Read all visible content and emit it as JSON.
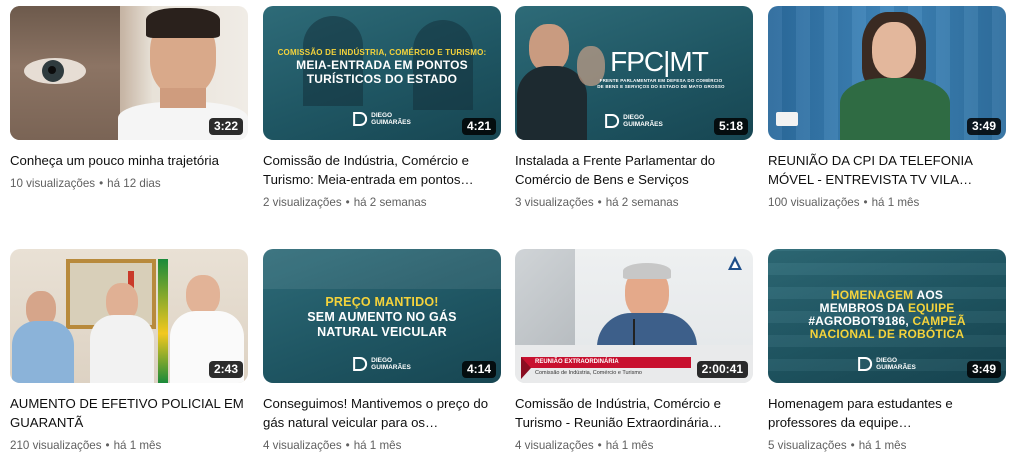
{
  "videos": [
    {
      "title": "Conheça um pouco minha trajetória",
      "views": "10 visualizações",
      "age": "há 12 dias",
      "duration": "3:22"
    },
    {
      "title": "Comissão de Indústria, Comércio e Turismo: Meia-entrada em pontos…",
      "views": "2 visualizações",
      "age": "há 2 semanas",
      "duration": "4:21",
      "thumb_small": "COMISSÃO DE INDÚSTRIA, COMÉRCIO E TURISMO:",
      "thumb_big_1": "MEIA-ENTRADA EM PONTOS",
      "thumb_big_2": "TURÍSTICOS DO ESTADO",
      "logo_1": "DIEGO",
      "logo_2": "GUIMARÃES"
    },
    {
      "title": "Instalada a Frente Parlamentar do Comércio de Bens e Serviços",
      "views": "3 visualizações",
      "age": "há 2 semanas",
      "duration": "5:18",
      "thumb_logo": "FPC|MT",
      "thumb_small_1": "FRENTE PARLAMENTAR EM DEFESA DO COMÉRCIO",
      "thumb_small_2": "DE BENS E SERVIÇOS DO ESTADO DE MATO GROSSO",
      "logo_1": "DIEGO",
      "logo_2": "GUIMARÃES"
    },
    {
      "title": "REUNIÃO DA CPI DA TELEFONIA MÓVEL - ENTREVISTA TV VILA…",
      "views": "100 visualizações",
      "age": "há 1 mês",
      "duration": "3:49"
    },
    {
      "title": "AUMENTO DE EFETIVO POLICIAL EM GUARANTÃ",
      "views": "210 visualizações",
      "age": "há 1 mês",
      "duration": "2:43"
    },
    {
      "title": "Conseguimos! Mantivemos o preço do gás natural veicular para os…",
      "views": "4 visualizações",
      "age": "há 1 mês",
      "duration": "4:14",
      "thumb_yellow": "PREÇO MANTIDO!",
      "thumb_big_1": "SEM AUMENTO NO GÁS",
      "thumb_big_2": "NATURAL VEICULAR",
      "logo_1": "DIEGO",
      "logo_2": "GUIMARÃES"
    },
    {
      "title": "Comissão de Indústria, Comércio e Turismo - Reunião Extraordinária…",
      "views": "4 visualizações",
      "age": "há 1 mês",
      "duration": "2:00:41",
      "thumb_banner_1": "REUNIÃO EXTRAORDINÁRIA",
      "thumb_banner_2": "Comissão de Indústria, Comércio e Turismo"
    },
    {
      "title": "Homenagem para estudantes e professores da equipe…",
      "views": "5 visualizações",
      "age": "há 1 mês",
      "duration": "3:49",
      "thumb_line_1a": "HOMENAGEM",
      "thumb_line_1b": " AOS",
      "thumb_line_2a": "MEMBROS DA ",
      "thumb_line_2b": "EQUIPE",
      "thumb_line_3a": "#AGROBOT9186, ",
      "thumb_line_3b": "CAMPEÃ",
      "thumb_line_4": "NACIONAL DE ROBÓTICA",
      "logo_1": "DIEGO",
      "logo_2": "GUIMARÃES"
    }
  ]
}
